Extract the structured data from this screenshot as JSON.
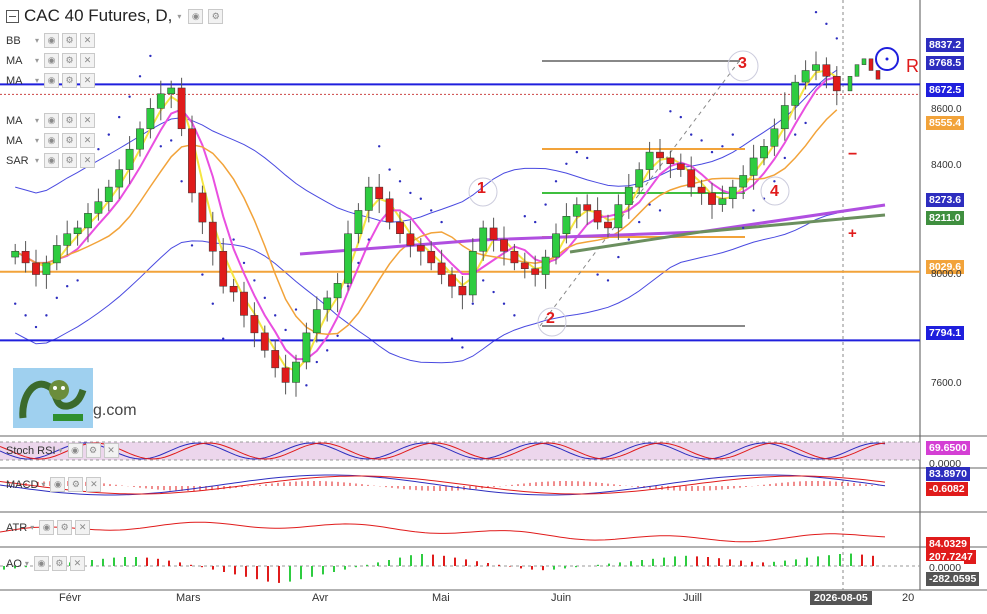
{
  "header": {
    "title": "CAC 40 Futures, D,"
  },
  "legend_items": [
    {
      "label": "BB",
      "top": 33
    },
    {
      "label": "MA",
      "top": 53
    },
    {
      "label": "MA",
      "top": 73
    },
    {
      "label": "MA",
      "top": 113
    },
    {
      "label": "MA",
      "top": 133
    },
    {
      "label": "SAR",
      "top": 153
    }
  ],
  "panels": {
    "stoch_rsi": "Stoch RSI",
    "macd": "MACD",
    "atr": "ATR",
    "ao": "AO"
  },
  "logo_text": "g.com",
  "annotations": {
    "wave_1": "1",
    "wave_2": "2",
    "wave_3": "3",
    "wave_4": "4",
    "R": "R",
    "minus": "−",
    "plus": "+"
  },
  "price_labels": [
    {
      "text": "8837.2",
      "color": "#2d2dbf"
    },
    {
      "text": "8768.5",
      "color": "#2d2dbf"
    },
    {
      "text": "8672.5",
      "color": "#1f1fdd"
    },
    {
      "text": "8555.4",
      "color": "#f2a33a"
    },
    {
      "text": "8273.6",
      "color": "#2d2dbf"
    },
    {
      "text": "8211.0",
      "color": "#3f8f3f"
    },
    {
      "text": "8029.6",
      "color": "#f2a33a"
    },
    {
      "text": "7794.1",
      "color": "#1f1fdd"
    }
  ],
  "indicator_labels": {
    "stoch": {
      "value": "69.6500",
      "zero": "0.0000",
      "color": "#d43fd4"
    },
    "macd": {
      "value1": "83.8970",
      "value2": "-0.6082",
      "color1": "#2d2dbf",
      "color2": "#e01b1b"
    },
    "atr": {
      "value": "84.0329",
      "color": "#e01b1b"
    },
    "ao": {
      "value1": "207.7247",
      "zero": "0.0000",
      "value2": "-282.0595",
      "color1": "#e01b1b",
      "color2": "#555555"
    }
  },
  "axis": {
    "price_ticks": [
      "8600.0",
      "8400.0",
      "8000.0",
      "7600.0"
    ],
    "months": [
      "Févr",
      "Mars",
      "Avr",
      "Mai",
      "Juin",
      "Juill",
      "20"
    ],
    "cursor_date": "2026-08-05"
  },
  "chart_data": {
    "type": "candlestick",
    "symbol": "CAC 40 Futures",
    "timeframe": "D",
    "y_range": [
      7480,
      8900
    ],
    "levels": [
      8672.5,
      8029.6,
      7794.1
    ],
    "ohlc_closes": [
      8100,
      8060,
      8020,
      8060,
      8120,
      8160,
      8180,
      8230,
      8270,
      8320,
      8380,
      8450,
      8520,
      8590,
      8640,
      8660,
      8520,
      8300,
      8200,
      8100,
      7980,
      7960,
      7880,
      7820,
      7760,
      7700,
      7650,
      7720,
      7820,
      7900,
      7940,
      7990,
      8160,
      8240,
      8320,
      8280,
      8200,
      8160,
      8120,
      8100,
      8060,
      8020,
      7980,
      7950,
      8100,
      8180,
      8140,
      8100,
      8060,
      8040,
      8020,
      8080,
      8160,
      8220,
      8260,
      8240,
      8200,
      8180,
      8260,
      8320,
      8380,
      8440,
      8420,
      8400,
      8380,
      8320,
      8300,
      8260,
      8280,
      8320,
      8360,
      8420,
      8460,
      8520,
      8600,
      8680,
      8720,
      8740,
      8700,
      8650
    ],
    "ao_values": [
      -60,
      -40,
      -20,
      0,
      20,
      40,
      60,
      80,
      100,
      120,
      140,
      150,
      150,
      140,
      120,
      90,
      60,
      20,
      -20,
      -60,
      -100,
      -140,
      -180,
      -220,
      -260,
      -282,
      -260,
      -220,
      -180,
      -140,
      -100,
      -60,
      -20,
      20,
      60,
      100,
      140,
      180,
      200,
      190,
      170,
      140,
      110,
      80,
      50,
      20,
      -10,
      -40,
      -60,
      -70,
      -60,
      -40,
      -20,
      0,
      20,
      40,
      60,
      80,
      100,
      120,
      140,
      160,
      170,
      160,
      150,
      130,
      110,
      90,
      70,
      60,
      70,
      90,
      110,
      140,
      160,
      180,
      200,
      207,
      190,
      170
    ]
  }
}
